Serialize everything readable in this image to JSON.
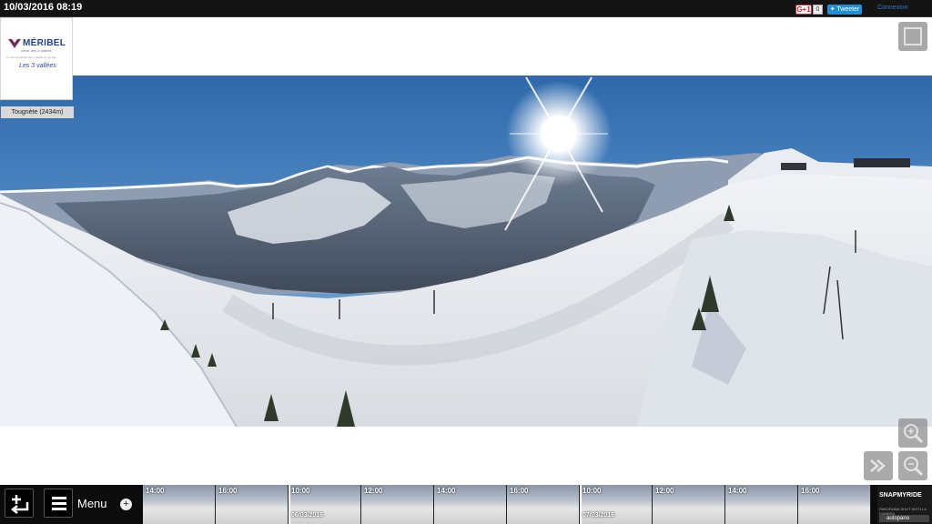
{
  "header": {
    "timestamp": "10/03/2016 08:19",
    "gplus_label": "G+1",
    "gplus_count": "0",
    "tweet_label": "Tweeter",
    "connexion_label": "Connexion"
  },
  "logo": {
    "brand": "MÉRIBEL",
    "tagline": "cœur des 3 vallées",
    "subline": "Le plus grand domaine skiable du monde",
    "partner": "Les 3 vallées"
  },
  "station_label": "Tougnète (2434m)",
  "menu": {
    "label": "Menu"
  },
  "timeline": {
    "thumbs": [
      {
        "time": "14:00",
        "date": ""
      },
      {
        "time": "16:00",
        "date": ""
      },
      {
        "time": "10:00",
        "date": "06/03/2016"
      },
      {
        "time": "12:00",
        "date": ""
      },
      {
        "time": "14:00",
        "date": ""
      },
      {
        "time": "16:00",
        "date": ""
      },
      {
        "time": "10:00",
        "date": "07/03/2016"
      },
      {
        "time": "12:00",
        "date": ""
      },
      {
        "time": "14:00",
        "date": ""
      },
      {
        "time": "16:00",
        "date": ""
      }
    ]
  },
  "credits": {
    "brand": "SNAPMYRIDE",
    "subline": "PANORAMA SHOT WITH LA CAMERA",
    "product": "autopano"
  },
  "icons": {
    "fullscreen": "fullscreen-icon",
    "zoom_in": "zoom-in-icon",
    "zoom_out": "zoom-out-icon",
    "skip": "fast-forward-icon",
    "add": "add-arrow-icon",
    "menu": "hamburger-icon",
    "plus": "plus-icon"
  }
}
